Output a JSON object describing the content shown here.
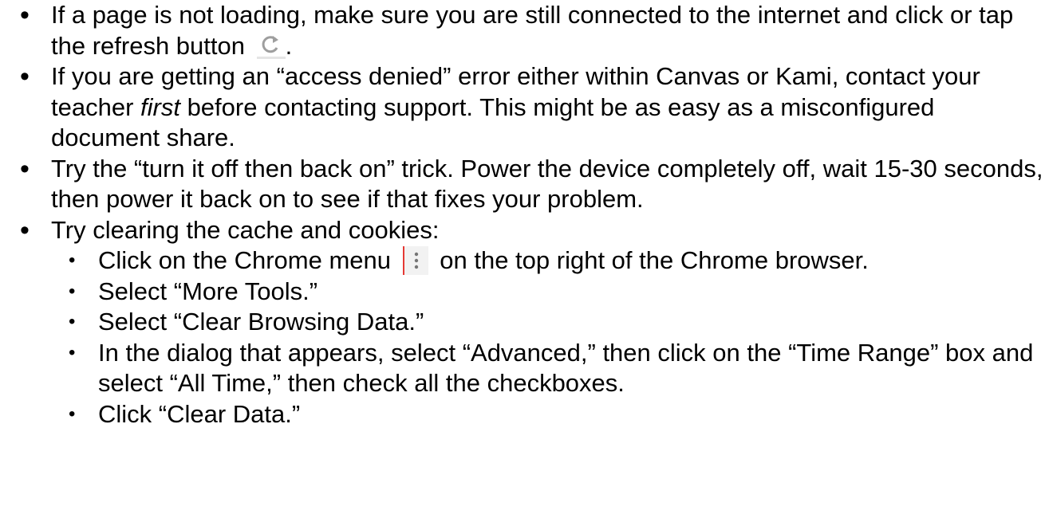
{
  "items": [
    {
      "text_before": "If a page is not loading, make sure you are still connected to the internet and click or tap the refresh button",
      "text_after": ".",
      "icon": "refresh-icon"
    },
    {
      "text_before": "If you are getting an “access denied” error either within Canvas or Kami, contact your teacher ",
      "emphasis": "first",
      "text_after": " before contacting support. This might be as easy as a misconfigured document share."
    },
    {
      "text": "Try the “turn it off then back on” trick. Power the device completely off, wait 15-30 seconds, then power it back on to see if that fixes your problem."
    },
    {
      "text": "Try clearing the cache and cookies:",
      "subitems": [
        {
          "text_before": "Click on the Chrome menu",
          "icon": "chrome-menu-icon",
          "text_after": "on the top right of the Chrome browser."
        },
        {
          "text": "Select “More Tools.”"
        },
        {
          "text": "Select “Clear Browsing Data.”"
        },
        {
          "text": "In the dialog that appears, select “Advanced,” then click on the “Time Range” box and select “All Time,” then check all the checkboxes."
        },
        {
          "text": "Click “Clear Data.”"
        }
      ]
    }
  ],
  "colors": {
    "text": "#000000",
    "refresh_icon": "#9e9e9e",
    "menu_icon_dots": "#757575",
    "menu_icon_accent": "#e53935"
  }
}
